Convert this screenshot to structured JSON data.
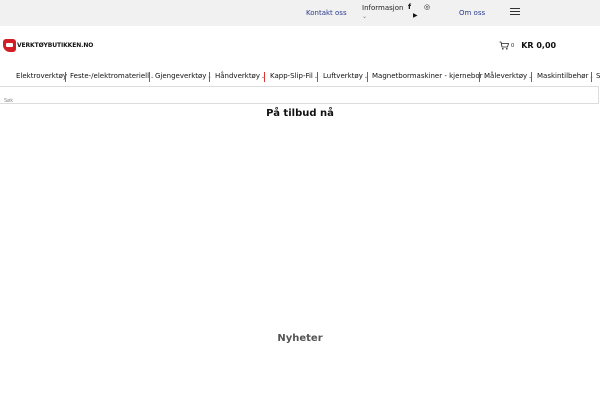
{
  "topbar": {
    "contact": "Kontakt oss",
    "info": "Informasjon",
    "info_chevron": "⌄",
    "about": "Om oss",
    "facebook": "f",
    "instagram": "◎",
    "youtube": "▶"
  },
  "logo": {
    "text": "VERKTØYBUTIKKEN.NO"
  },
  "cart": {
    "count": "0",
    "total": "KR 0,00"
  },
  "nav": {
    "items": [
      {
        "label": "Elektroverktøy",
        "dd": ""
      },
      {
        "label": "Feste-/elektromateriell",
        "dd": "⌄"
      },
      {
        "label": "Gjengeverktøy",
        "dd": "⌄"
      },
      {
        "label": "Håndverktøy",
        "dd": "⌄"
      },
      {
        "label": "Kapp-Slip-Fil",
        "dd": "⌄"
      },
      {
        "label": "Luftverktøy",
        "dd": "⌄"
      },
      {
        "label": "Magnetbormaskiner - kjernebor",
        "dd": "⌄"
      },
      {
        "label": "Måleverktøy",
        "dd": "⌄"
      },
      {
        "label": "Maskintilbehør",
        "dd": "⌄"
      },
      {
        "label": "S",
        "dd": ""
      }
    ]
  },
  "search": {
    "placeholder": "Søk"
  },
  "sections": {
    "offers": "På tilbud nå",
    "news": "Nyheter"
  },
  "colors": {
    "accent": "#d21f26",
    "link": "#2a3a8c"
  }
}
